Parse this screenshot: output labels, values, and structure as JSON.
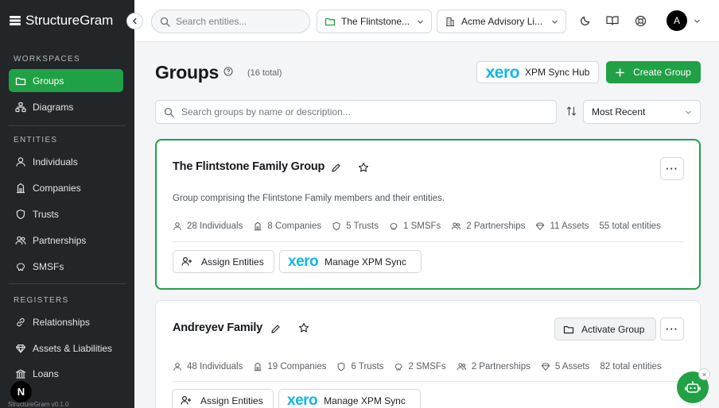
{
  "app": {
    "name": "StructureGram",
    "version": "StructureGram v0.1.0",
    "accent": "#20a145"
  },
  "topbar": {
    "search_placeholder": "Search entities...",
    "group_selector": "The Flintstone...",
    "firm_selector": "Acme Advisory Li...",
    "avatar_initial": "A"
  },
  "sidebar": {
    "sections": [
      {
        "label": "WORKSPACES",
        "items": [
          {
            "label": "Groups",
            "icon": "folder-icon",
            "active": true
          },
          {
            "label": "Diagrams",
            "icon": "sitemap-icon"
          }
        ]
      },
      {
        "label": "ENTITIES",
        "items": [
          {
            "label": "Individuals",
            "icon": "user-icon"
          },
          {
            "label": "Companies",
            "icon": "building-icon"
          },
          {
            "label": "Trusts",
            "icon": "shield-icon"
          },
          {
            "label": "Partnerships",
            "icon": "users-icon"
          },
          {
            "label": "SMSFs",
            "icon": "piggy-bank-icon"
          }
        ]
      },
      {
        "label": "REGISTERS",
        "items": [
          {
            "label": "Relationships",
            "icon": "link-icon"
          },
          {
            "label": "Assets & Liabilities",
            "icon": "gem-icon"
          },
          {
            "label": "Loans",
            "icon": "bank-icon"
          }
        ]
      }
    ],
    "bottom_badge": "N"
  },
  "page": {
    "title": "Groups",
    "total": "(16 total)",
    "xpm_button": "XPM Sync Hub",
    "create_button": "Create Group",
    "search_placeholder": "Search groups by name or description...",
    "sort_value": "Most Recent",
    "xero_logo": "xero"
  },
  "groups": [
    {
      "name": "The Flintstone Family Group",
      "description": "Group comprising the Flintstone Family members and their entities.",
      "stats": {
        "individuals": "28 Individuals",
        "companies": "8 Companies",
        "trusts": "5 Trusts",
        "smsfs": "1 SMSFs",
        "partnerships": "2 Partnerships",
        "assets": "11 Assets",
        "total": "55 total entities"
      },
      "assign_label": "Assign Entities",
      "sync_label": "Manage XPM Sync"
    },
    {
      "name": "Andreyev Family",
      "activate_label": "Activate Group",
      "stats": {
        "individuals": "48 Individuals",
        "companies": "19 Companies",
        "trusts": "6 Trusts",
        "smsfs": "2 SMSFs",
        "partnerships": "2 Partnerships",
        "assets": "5 Assets",
        "total": "82 total entities"
      },
      "assign_label": "Assign Entities",
      "sync_label": "Manage XPM Sync"
    }
  ]
}
